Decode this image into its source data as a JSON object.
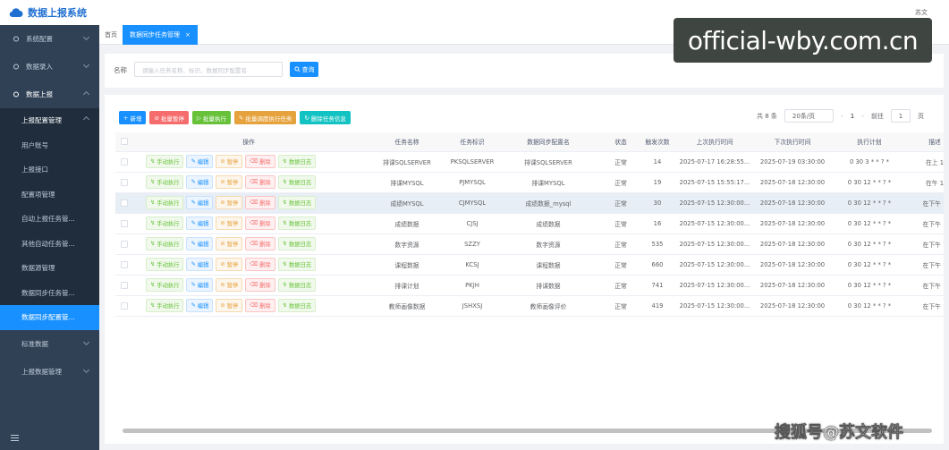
{
  "app": {
    "title": "数据上报系统",
    "user": "苏文"
  },
  "sidebar": {
    "items": [
      {
        "label": "系统配置"
      },
      {
        "label": "数据录入"
      },
      {
        "label": "数据上报"
      }
    ],
    "sub_group": "上报配置管理",
    "sub_items": [
      {
        "label": "用户账号"
      },
      {
        "label": "上报接口"
      },
      {
        "label": "配置项管理"
      },
      {
        "label": "自动上报任务管..."
      },
      {
        "label": "其他自动任务管..."
      },
      {
        "label": "数据源管理"
      },
      {
        "label": "数据同步任务管..."
      },
      {
        "label": "数据同步配置管..."
      }
    ],
    "tail_items": [
      {
        "label": "标准数据"
      },
      {
        "label": "上报数据管理"
      }
    ]
  },
  "tabs": {
    "home": "首页",
    "active": "数据同步任务管理",
    "close": "×"
  },
  "search": {
    "label": "名称",
    "placeholder": "请输入任务名称、标识、数据同步配置名",
    "button": "查询"
  },
  "toolbar": {
    "add": "新增",
    "batch_pause": "批量暂停",
    "batch_run": "批量执行",
    "batch_schedule": "批量调度执行任务",
    "delete_info": "删除任务信息"
  },
  "pager": {
    "total": "共 8 条",
    "size": "20条/页",
    "page": "1",
    "goto": "前往",
    "goto_value": "1",
    "unit": "页"
  },
  "table": {
    "headers": [
      "操作",
      "任务名称",
      "任务标识",
      "数据同步配置名",
      "状态",
      "触发次数",
      "上次执行时间",
      "下次执行时间",
      "执行计划",
      "描述"
    ],
    "op_labels": {
      "run": "手动执行",
      "edit": "编辑",
      "pause": "暂停",
      "delete": "删除",
      "log": "数据日志"
    },
    "rows": [
      {
        "name": "排课SQLSERVER",
        "code": "PKSQLSERVER",
        "config": "排课SQLSERVER",
        "status": "正常",
        "count": "14",
        "last": "2025-07-17 16:28:55...",
        "next": "2025-07-19 03:30:00",
        "cron": "0 30 3 * * ? *",
        "desc": "在上 1"
      },
      {
        "name": "排课MYSQL",
        "code": "PJMYSQL",
        "config": "排课MYSQL",
        "status": "正常",
        "count": "19",
        "last": "2025-07-15 15:55:17...",
        "next": "2025-07-18 12:30:00",
        "cron": "0 30 12 * * ? *",
        "desc": "在午 1"
      },
      {
        "name": "成绩MYSQL",
        "code": "CJMYSQL",
        "config": "成绩数据_mysql",
        "status": "正常",
        "count": "30",
        "last": "2025-07-15 12:30:00...",
        "next": "2025-07-18 12:30:00",
        "cron": "0 30 12 * * ? *",
        "desc": "在下午 1"
      },
      {
        "name": "成绩数据",
        "code": "CJSJ",
        "config": "成绩数据",
        "status": "正常",
        "count": "16",
        "last": "2025-07-15 12:30:00...",
        "next": "2025-07-18 12:30:00",
        "cron": "0 30 12 * * ? *",
        "desc": "在下午 1"
      },
      {
        "name": "数字资源",
        "code": "SZZY",
        "config": "数字资源",
        "status": "正常",
        "count": "535",
        "last": "2025-07-15 12:30:00...",
        "next": "2025-07-18 12:30:00",
        "cron": "0 30 12 * * ? *",
        "desc": "在下午 1"
      },
      {
        "name": "课程数据",
        "code": "KCSJ",
        "config": "课程数据",
        "status": "正常",
        "count": "660",
        "last": "2025-07-15 12:30:00...",
        "next": "2025-07-18 12:30:00",
        "cron": "0 30 12 * * ? *",
        "desc": "在下午 1"
      },
      {
        "name": "排课计划",
        "code": "PKJH",
        "config": "排课数据",
        "status": "正常",
        "count": "741",
        "last": "2025-07-15 12:30:00...",
        "next": "2025-07-18 12:30:00",
        "cron": "0 30 12 * * ? *",
        "desc": "在下午 1"
      },
      {
        "name": "教师画像数据",
        "code": "JSHXSJ",
        "config": "教师画像评价",
        "status": "正常",
        "count": "419",
        "last": "2025-07-15 12:30:00...",
        "next": "2025-07-18 12:30:00",
        "cron": "0 30 12 * * ? *",
        "desc": "在下午 1"
      }
    ]
  },
  "watermarks": {
    "url": "official-wby.com.cn",
    "bottom": "搜狐号@苏文软件"
  },
  "colors": {
    "primary": "#1890ff",
    "sidebar_bg": "#304156",
    "submenu_bg": "#1f2d3d",
    "success": "#67c23a",
    "warning": "#e6a23c",
    "danger": "#f56c6c"
  }
}
